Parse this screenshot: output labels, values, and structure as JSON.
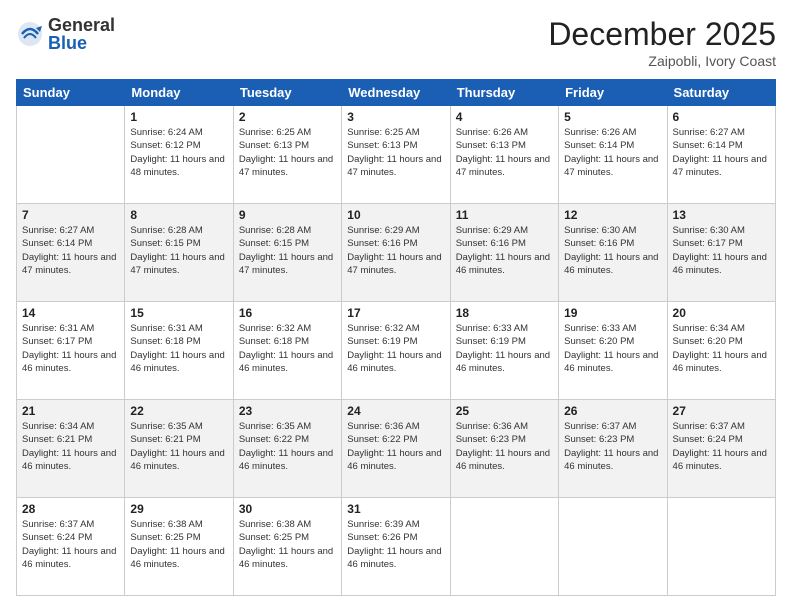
{
  "logo": {
    "general": "General",
    "blue": "Blue"
  },
  "header": {
    "month": "December 2025",
    "location": "Zaipobli, Ivory Coast"
  },
  "weekdays": [
    "Sunday",
    "Monday",
    "Tuesday",
    "Wednesday",
    "Thursday",
    "Friday",
    "Saturday"
  ],
  "weeks": [
    [
      {
        "day": "",
        "sunrise": "",
        "sunset": "",
        "daylight": ""
      },
      {
        "day": "1",
        "sunrise": "Sunrise: 6:24 AM",
        "sunset": "Sunset: 6:12 PM",
        "daylight": "Daylight: 11 hours and 48 minutes."
      },
      {
        "day": "2",
        "sunrise": "Sunrise: 6:25 AM",
        "sunset": "Sunset: 6:13 PM",
        "daylight": "Daylight: 11 hours and 47 minutes."
      },
      {
        "day": "3",
        "sunrise": "Sunrise: 6:25 AM",
        "sunset": "Sunset: 6:13 PM",
        "daylight": "Daylight: 11 hours and 47 minutes."
      },
      {
        "day": "4",
        "sunrise": "Sunrise: 6:26 AM",
        "sunset": "Sunset: 6:13 PM",
        "daylight": "Daylight: 11 hours and 47 minutes."
      },
      {
        "day": "5",
        "sunrise": "Sunrise: 6:26 AM",
        "sunset": "Sunset: 6:14 PM",
        "daylight": "Daylight: 11 hours and 47 minutes."
      },
      {
        "day": "6",
        "sunrise": "Sunrise: 6:27 AM",
        "sunset": "Sunset: 6:14 PM",
        "daylight": "Daylight: 11 hours and 47 minutes."
      }
    ],
    [
      {
        "day": "7",
        "sunrise": "Sunrise: 6:27 AM",
        "sunset": "Sunset: 6:14 PM",
        "daylight": "Daylight: 11 hours and 47 minutes."
      },
      {
        "day": "8",
        "sunrise": "Sunrise: 6:28 AM",
        "sunset": "Sunset: 6:15 PM",
        "daylight": "Daylight: 11 hours and 47 minutes."
      },
      {
        "day": "9",
        "sunrise": "Sunrise: 6:28 AM",
        "sunset": "Sunset: 6:15 PM",
        "daylight": "Daylight: 11 hours and 47 minutes."
      },
      {
        "day": "10",
        "sunrise": "Sunrise: 6:29 AM",
        "sunset": "Sunset: 6:16 PM",
        "daylight": "Daylight: 11 hours and 47 minutes."
      },
      {
        "day": "11",
        "sunrise": "Sunrise: 6:29 AM",
        "sunset": "Sunset: 6:16 PM",
        "daylight": "Daylight: 11 hours and 46 minutes."
      },
      {
        "day": "12",
        "sunrise": "Sunrise: 6:30 AM",
        "sunset": "Sunset: 6:16 PM",
        "daylight": "Daylight: 11 hours and 46 minutes."
      },
      {
        "day": "13",
        "sunrise": "Sunrise: 6:30 AM",
        "sunset": "Sunset: 6:17 PM",
        "daylight": "Daylight: 11 hours and 46 minutes."
      }
    ],
    [
      {
        "day": "14",
        "sunrise": "Sunrise: 6:31 AM",
        "sunset": "Sunset: 6:17 PM",
        "daylight": "Daylight: 11 hours and 46 minutes."
      },
      {
        "day": "15",
        "sunrise": "Sunrise: 6:31 AM",
        "sunset": "Sunset: 6:18 PM",
        "daylight": "Daylight: 11 hours and 46 minutes."
      },
      {
        "day": "16",
        "sunrise": "Sunrise: 6:32 AM",
        "sunset": "Sunset: 6:18 PM",
        "daylight": "Daylight: 11 hours and 46 minutes."
      },
      {
        "day": "17",
        "sunrise": "Sunrise: 6:32 AM",
        "sunset": "Sunset: 6:19 PM",
        "daylight": "Daylight: 11 hours and 46 minutes."
      },
      {
        "day": "18",
        "sunrise": "Sunrise: 6:33 AM",
        "sunset": "Sunset: 6:19 PM",
        "daylight": "Daylight: 11 hours and 46 minutes."
      },
      {
        "day": "19",
        "sunrise": "Sunrise: 6:33 AM",
        "sunset": "Sunset: 6:20 PM",
        "daylight": "Daylight: 11 hours and 46 minutes."
      },
      {
        "day": "20",
        "sunrise": "Sunrise: 6:34 AM",
        "sunset": "Sunset: 6:20 PM",
        "daylight": "Daylight: 11 hours and 46 minutes."
      }
    ],
    [
      {
        "day": "21",
        "sunrise": "Sunrise: 6:34 AM",
        "sunset": "Sunset: 6:21 PM",
        "daylight": "Daylight: 11 hours and 46 minutes."
      },
      {
        "day": "22",
        "sunrise": "Sunrise: 6:35 AM",
        "sunset": "Sunset: 6:21 PM",
        "daylight": "Daylight: 11 hours and 46 minutes."
      },
      {
        "day": "23",
        "sunrise": "Sunrise: 6:35 AM",
        "sunset": "Sunset: 6:22 PM",
        "daylight": "Daylight: 11 hours and 46 minutes."
      },
      {
        "day": "24",
        "sunrise": "Sunrise: 6:36 AM",
        "sunset": "Sunset: 6:22 PM",
        "daylight": "Daylight: 11 hours and 46 minutes."
      },
      {
        "day": "25",
        "sunrise": "Sunrise: 6:36 AM",
        "sunset": "Sunset: 6:23 PM",
        "daylight": "Daylight: 11 hours and 46 minutes."
      },
      {
        "day": "26",
        "sunrise": "Sunrise: 6:37 AM",
        "sunset": "Sunset: 6:23 PM",
        "daylight": "Daylight: 11 hours and 46 minutes."
      },
      {
        "day": "27",
        "sunrise": "Sunrise: 6:37 AM",
        "sunset": "Sunset: 6:24 PM",
        "daylight": "Daylight: 11 hours and 46 minutes."
      }
    ],
    [
      {
        "day": "28",
        "sunrise": "Sunrise: 6:37 AM",
        "sunset": "Sunset: 6:24 PM",
        "daylight": "Daylight: 11 hours and 46 minutes."
      },
      {
        "day": "29",
        "sunrise": "Sunrise: 6:38 AM",
        "sunset": "Sunset: 6:25 PM",
        "daylight": "Daylight: 11 hours and 46 minutes."
      },
      {
        "day": "30",
        "sunrise": "Sunrise: 6:38 AM",
        "sunset": "Sunset: 6:25 PM",
        "daylight": "Daylight: 11 hours and 46 minutes."
      },
      {
        "day": "31",
        "sunrise": "Sunrise: 6:39 AM",
        "sunset": "Sunset: 6:26 PM",
        "daylight": "Daylight: 11 hours and 46 minutes."
      },
      {
        "day": "",
        "sunrise": "",
        "sunset": "",
        "daylight": ""
      },
      {
        "day": "",
        "sunrise": "",
        "sunset": "",
        "daylight": ""
      },
      {
        "day": "",
        "sunrise": "",
        "sunset": "",
        "daylight": ""
      }
    ]
  ]
}
